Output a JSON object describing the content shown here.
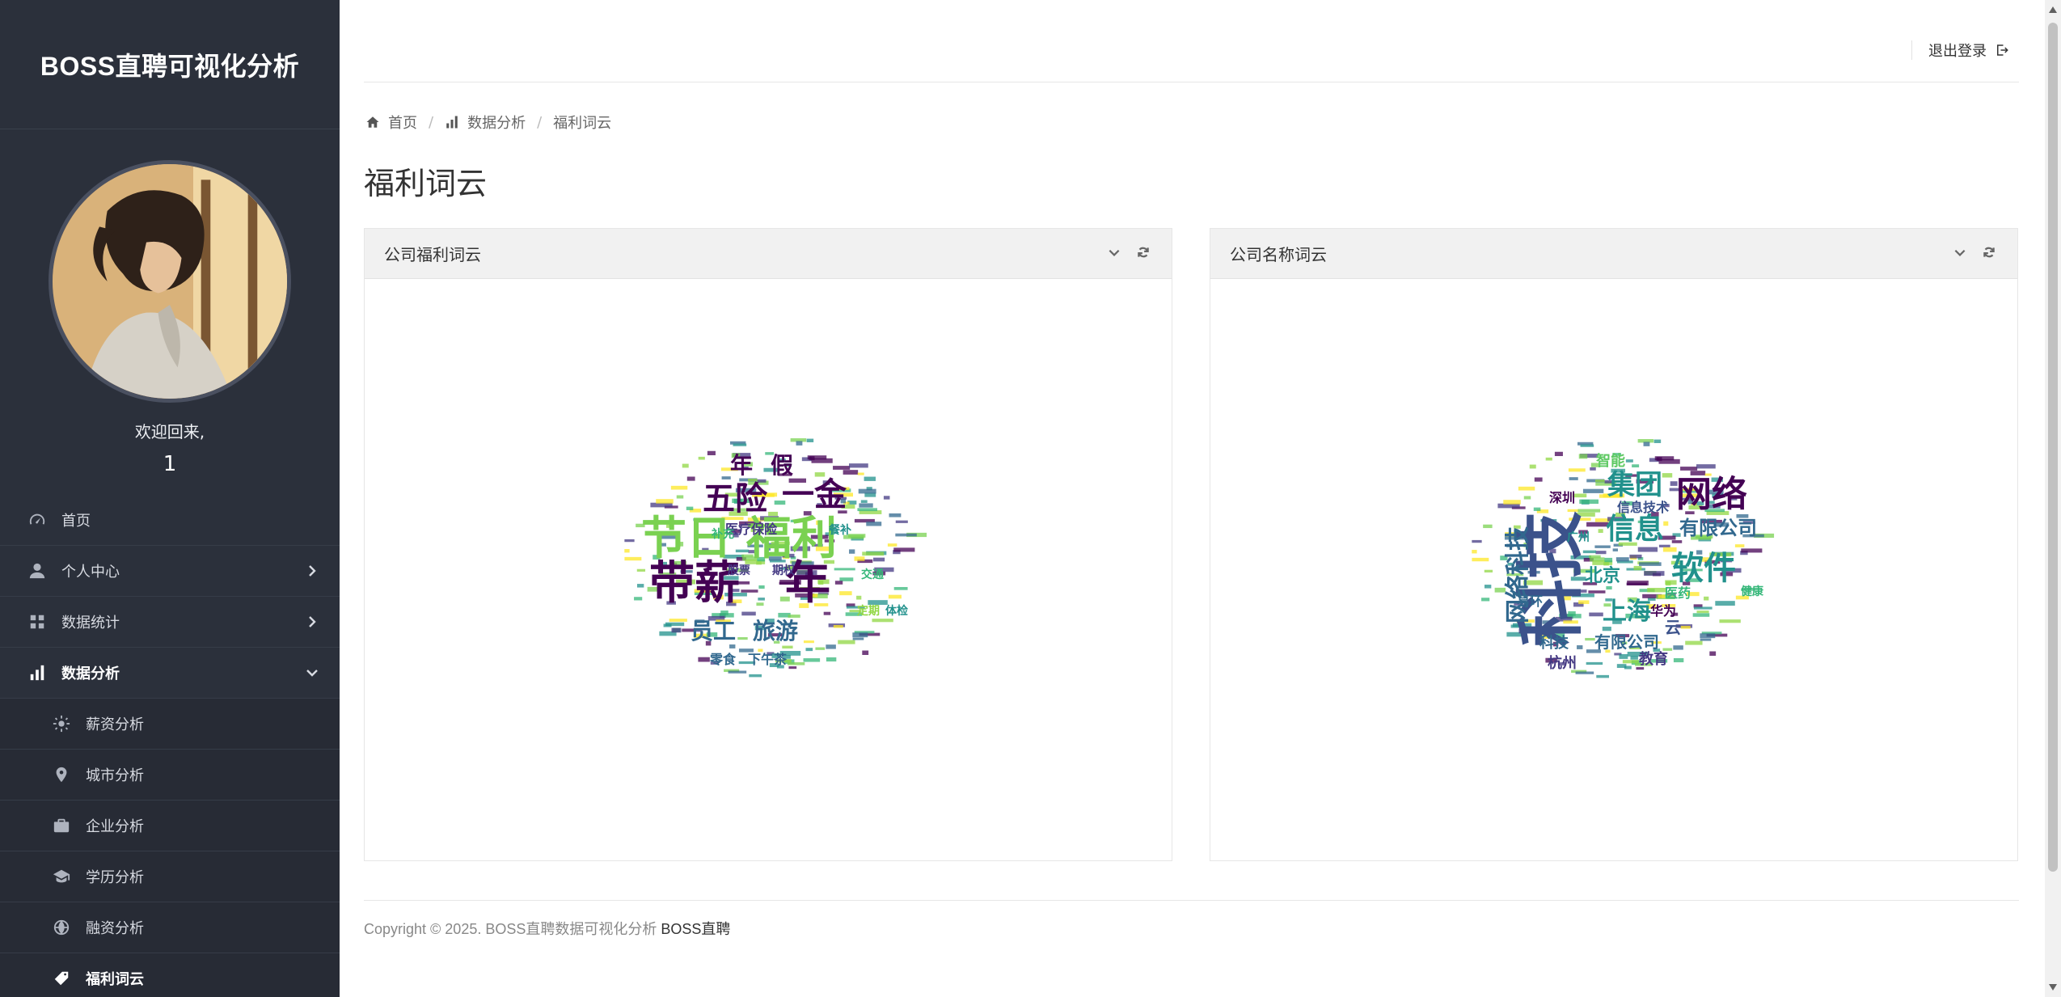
{
  "brand": {
    "title": "BOSS直聘可视化分析"
  },
  "profile": {
    "welcome": "欢迎回来,",
    "username": "1"
  },
  "nav": {
    "items": [
      {
        "label": "首页",
        "icon": "dashboard-gauge-icon"
      },
      {
        "label": "个人中心",
        "icon": "user-icon"
      },
      {
        "label": "数据统计",
        "icon": "grid-icon"
      },
      {
        "label": "数据分析",
        "icon": "bar-chart-icon"
      }
    ],
    "sub": [
      {
        "label": "薪资分析",
        "icon": "sun-icon"
      },
      {
        "label": "城市分析",
        "icon": "map-pin-icon"
      },
      {
        "label": "企业分析",
        "icon": "briefcase-icon"
      },
      {
        "label": "学历分析",
        "icon": "graduation-cap-icon"
      },
      {
        "label": "融资分析",
        "icon": "globe-icon"
      },
      {
        "label": "福利词云",
        "icon": "tag-icon"
      }
    ]
  },
  "topbar": {
    "logout": "退出登录"
  },
  "breadcrumb": {
    "home": "首页",
    "analysis": "数据分析",
    "current": "福利词云"
  },
  "page": {
    "title": "福利词云"
  },
  "panels": {
    "left": {
      "title": "公司福利词云"
    },
    "right": {
      "title": "公司名称词云"
    }
  },
  "cloud_left": {
    "words": [
      {
        "text": "节日",
        "color": "#7ad151"
      },
      {
        "text": "福利",
        "color": "#7ad151"
      },
      {
        "text": "带薪",
        "color": "#440154"
      },
      {
        "text": "年",
        "color": "#440154"
      },
      {
        "text": "五险",
        "color": "#440154"
      },
      {
        "text": "一金",
        "color": "#440154"
      },
      {
        "text": "年",
        "color": "#440154"
      },
      {
        "text": "假",
        "color": "#440154"
      },
      {
        "text": "员工",
        "color": "#31688e"
      },
      {
        "text": "旅游",
        "color": "#31688e"
      },
      {
        "text": "医疗保险",
        "color": "#443983"
      },
      {
        "text": "补充",
        "color": "#35b779"
      },
      {
        "text": "定期",
        "color": "#90d743"
      },
      {
        "text": "体检",
        "color": "#21918c"
      },
      {
        "text": "零食",
        "color": "#31688e"
      },
      {
        "text": "下午茶",
        "color": "#31688e"
      },
      {
        "text": "股票",
        "color": "#443983"
      },
      {
        "text": "期权",
        "color": "#443983"
      },
      {
        "text": "餐补",
        "color": "#21918c"
      },
      {
        "text": "交通",
        "color": "#35b779"
      }
    ]
  },
  "cloud_right": {
    "words": [
      {
        "text": "科技",
        "color": "#3b528b"
      },
      {
        "text": "网络",
        "color": "#440154"
      },
      {
        "text": "集团",
        "color": "#21918c"
      },
      {
        "text": "软件",
        "color": "#21918c"
      },
      {
        "text": "信息",
        "color": "#21918c"
      },
      {
        "text": "有限公司",
        "color": "#31688e"
      },
      {
        "text": "网络科技",
        "color": "#31688e"
      },
      {
        "text": "上海",
        "color": "#21918c"
      },
      {
        "text": "北京",
        "color": "#21918c"
      },
      {
        "text": "信息技术",
        "color": "#3b528b"
      },
      {
        "text": "智能",
        "color": "#5ec962"
      },
      {
        "text": "深圳",
        "color": "#440154"
      },
      {
        "text": "杭州",
        "color": "#443983"
      },
      {
        "text": "教育",
        "color": "#443983"
      },
      {
        "text": "科技",
        "color": "#31688e"
      },
      {
        "text": "有限公司",
        "color": "#31688e"
      },
      {
        "text": "云",
        "color": "#3b528b"
      },
      {
        "text": "华为",
        "color": "#440154"
      },
      {
        "text": "医药",
        "color": "#35b779"
      },
      {
        "text": "健康",
        "color": "#35b779"
      },
      {
        "text": "广州",
        "color": "#21918c"
      },
      {
        "text": "易环",
        "color": "#31688e"
      }
    ]
  },
  "footer": {
    "copyright": "Copyright © 2025. BOSS直聘数据可视化分析",
    "link": "BOSS直聘"
  }
}
